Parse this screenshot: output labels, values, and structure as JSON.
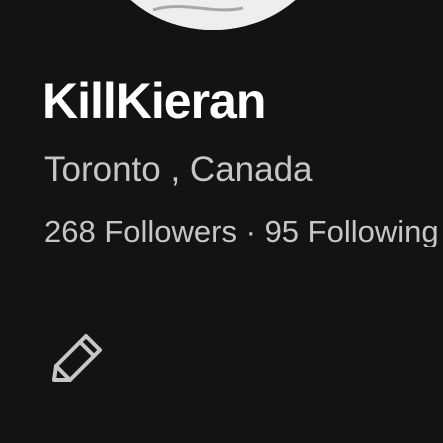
{
  "profile": {
    "username": "KillKieran",
    "location": "Toronto , Canada",
    "followers_text": "268 Followers",
    "separator": "·",
    "following_text": "95 Following"
  },
  "icons": {
    "edit": "pencil-icon",
    "avatar": "avatar"
  },
  "colors": {
    "background": "#131313",
    "username": "#ffffff",
    "secondary_text": "#c6c6c6",
    "icon_stroke": "#c6c6c6"
  }
}
